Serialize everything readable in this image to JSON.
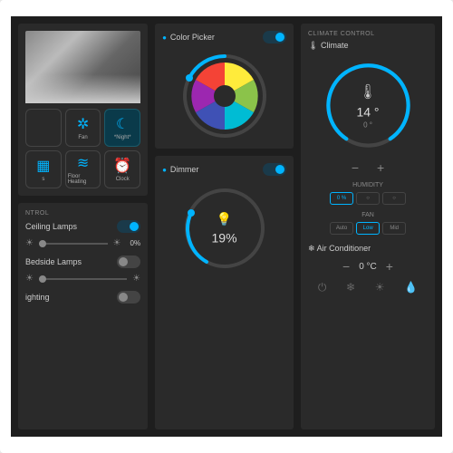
{
  "devices": [
    {
      "label": "",
      "icon": ""
    },
    {
      "label": "Fan",
      "icon": "✲"
    },
    {
      "label": "*Night*",
      "icon": "☾",
      "active": true
    },
    {
      "label": "s",
      "icon": "▦"
    },
    {
      "label": "Floor Heating",
      "icon": "≋"
    },
    {
      "label": "Clock",
      "icon": "⏰"
    }
  ],
  "control": {
    "section": "NTROL",
    "ceiling": {
      "label": "Ceiling Lamps",
      "pct": "0%"
    },
    "bedside": {
      "label": "Bedside Lamps"
    },
    "lighting": {
      "label": "ighting"
    }
  },
  "colorpicker": {
    "title": "Color Picker"
  },
  "dimmer": {
    "title": "Dimmer",
    "value": "19%"
  },
  "climate": {
    "section": "CLIMATE CONTROL",
    "title": "Climate",
    "temp": "14 °",
    "setpoint": "0 °",
    "humidity": {
      "title": "HUMIDITY",
      "opts": [
        "0 %",
        "○",
        "○"
      ]
    },
    "fan": {
      "title": "FAN",
      "opts": [
        "Auto",
        "Low",
        "Mid"
      ]
    },
    "ac": {
      "title": "Air Conditioner",
      "value": "0 °C"
    }
  }
}
